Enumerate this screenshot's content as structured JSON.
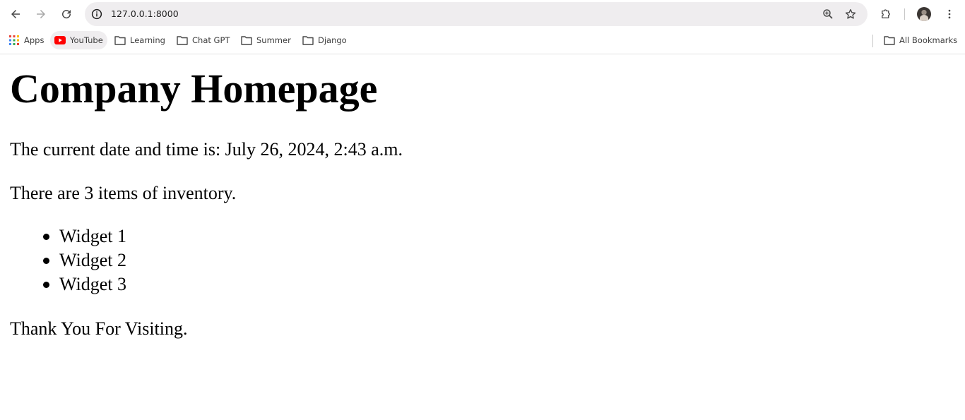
{
  "browser": {
    "url": "127.0.0.1:8000",
    "bookmarks": [
      {
        "label": "Apps",
        "icon": "apps-grid-icon"
      },
      {
        "label": "YouTube",
        "icon": "youtube-icon"
      },
      {
        "label": "Learning",
        "icon": "folder-icon"
      },
      {
        "label": "Chat GPT",
        "icon": "folder-icon"
      },
      {
        "label": "Summer",
        "icon": "folder-icon"
      },
      {
        "label": "Django",
        "icon": "folder-icon"
      }
    ],
    "all_bookmarks_label": "All Bookmarks",
    "colors": {
      "omnibox_bg": "#efedef",
      "youtube_red": "#ff0000"
    }
  },
  "page": {
    "title": "Company Homepage",
    "datetime_text": "The current date and time is: July 26, 2024, 2:43 a.m.",
    "inventory_text": "There are 3 items of inventory.",
    "items": [
      "Widget 1",
      "Widget 2",
      "Widget 3"
    ],
    "footer_text": "Thank You For Visiting."
  }
}
